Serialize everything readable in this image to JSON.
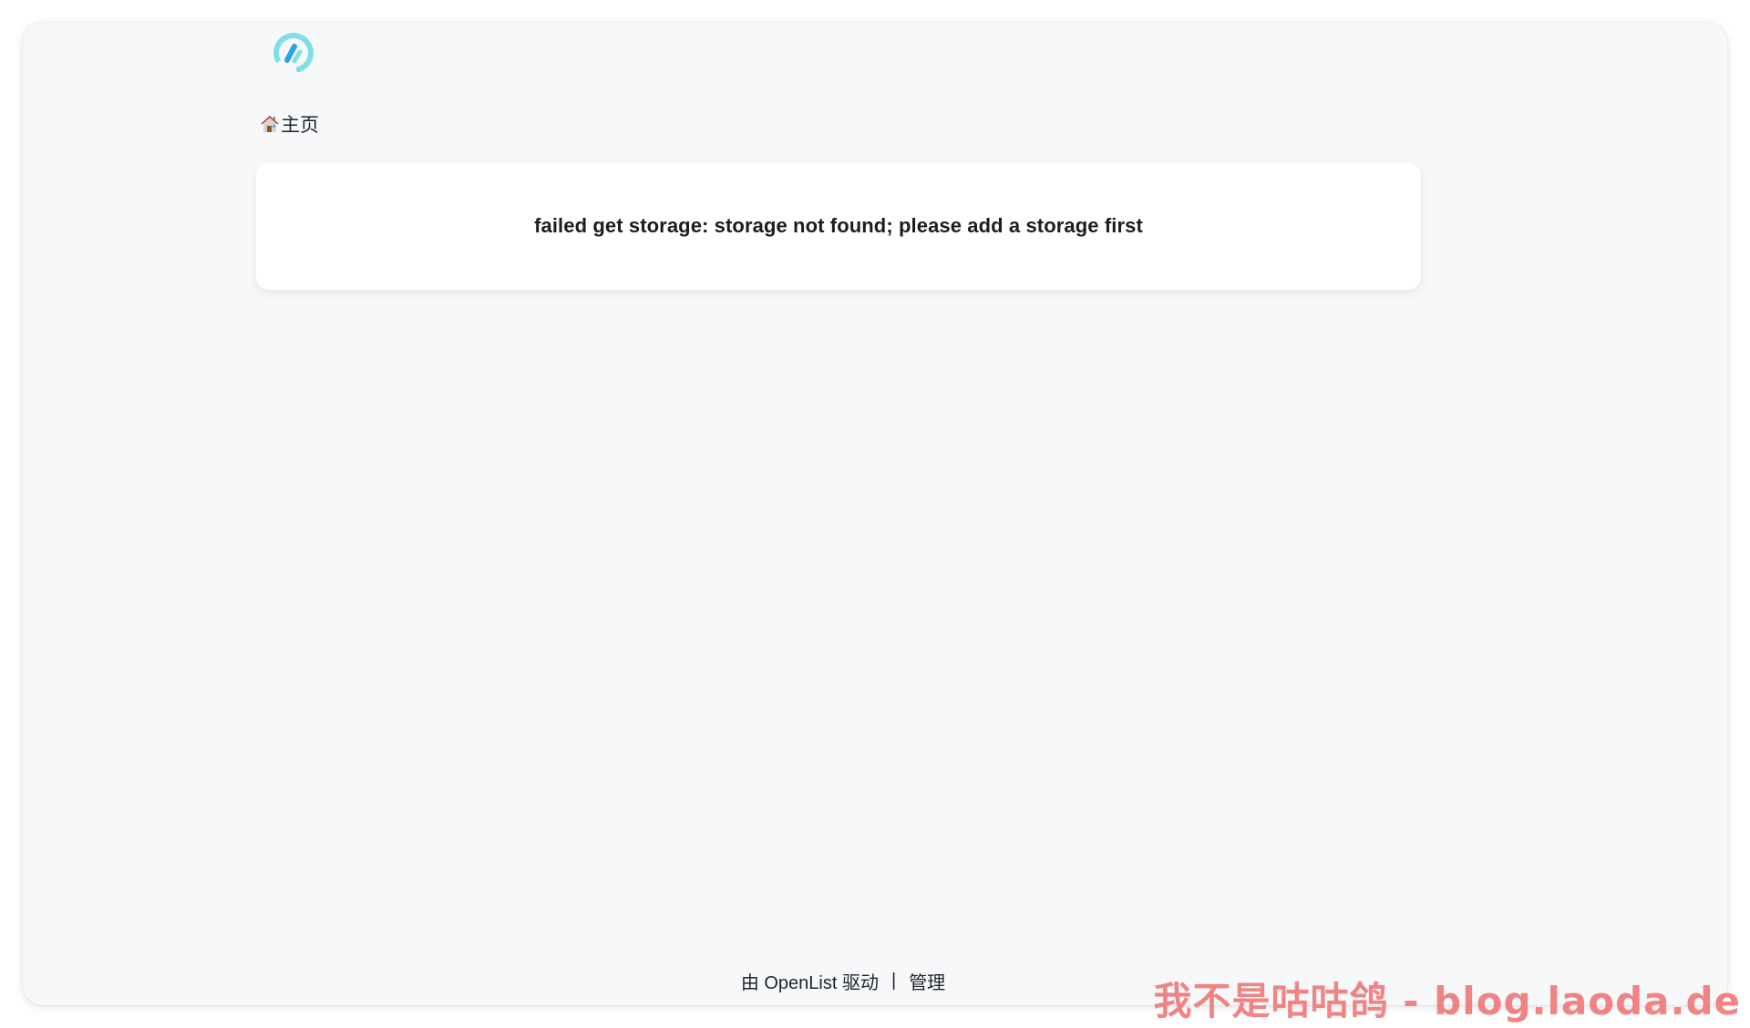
{
  "header": {
    "logo_icon": "openlist-logo-icon",
    "logo_colors": [
      "#2aa1e8",
      "#7ee0e6"
    ]
  },
  "breadcrumb": {
    "icon": "house-icon",
    "home_label": "主页"
  },
  "error": {
    "message": "failed get storage: storage not found; please add a storage first"
  },
  "footer": {
    "powered_by": "由 OpenList 驱动",
    "separator": "|",
    "manage_label": "管理"
  },
  "watermark": {
    "text": "我不是咕咕鸽 - blog.laoda.de",
    "color": "#f07a7a"
  }
}
